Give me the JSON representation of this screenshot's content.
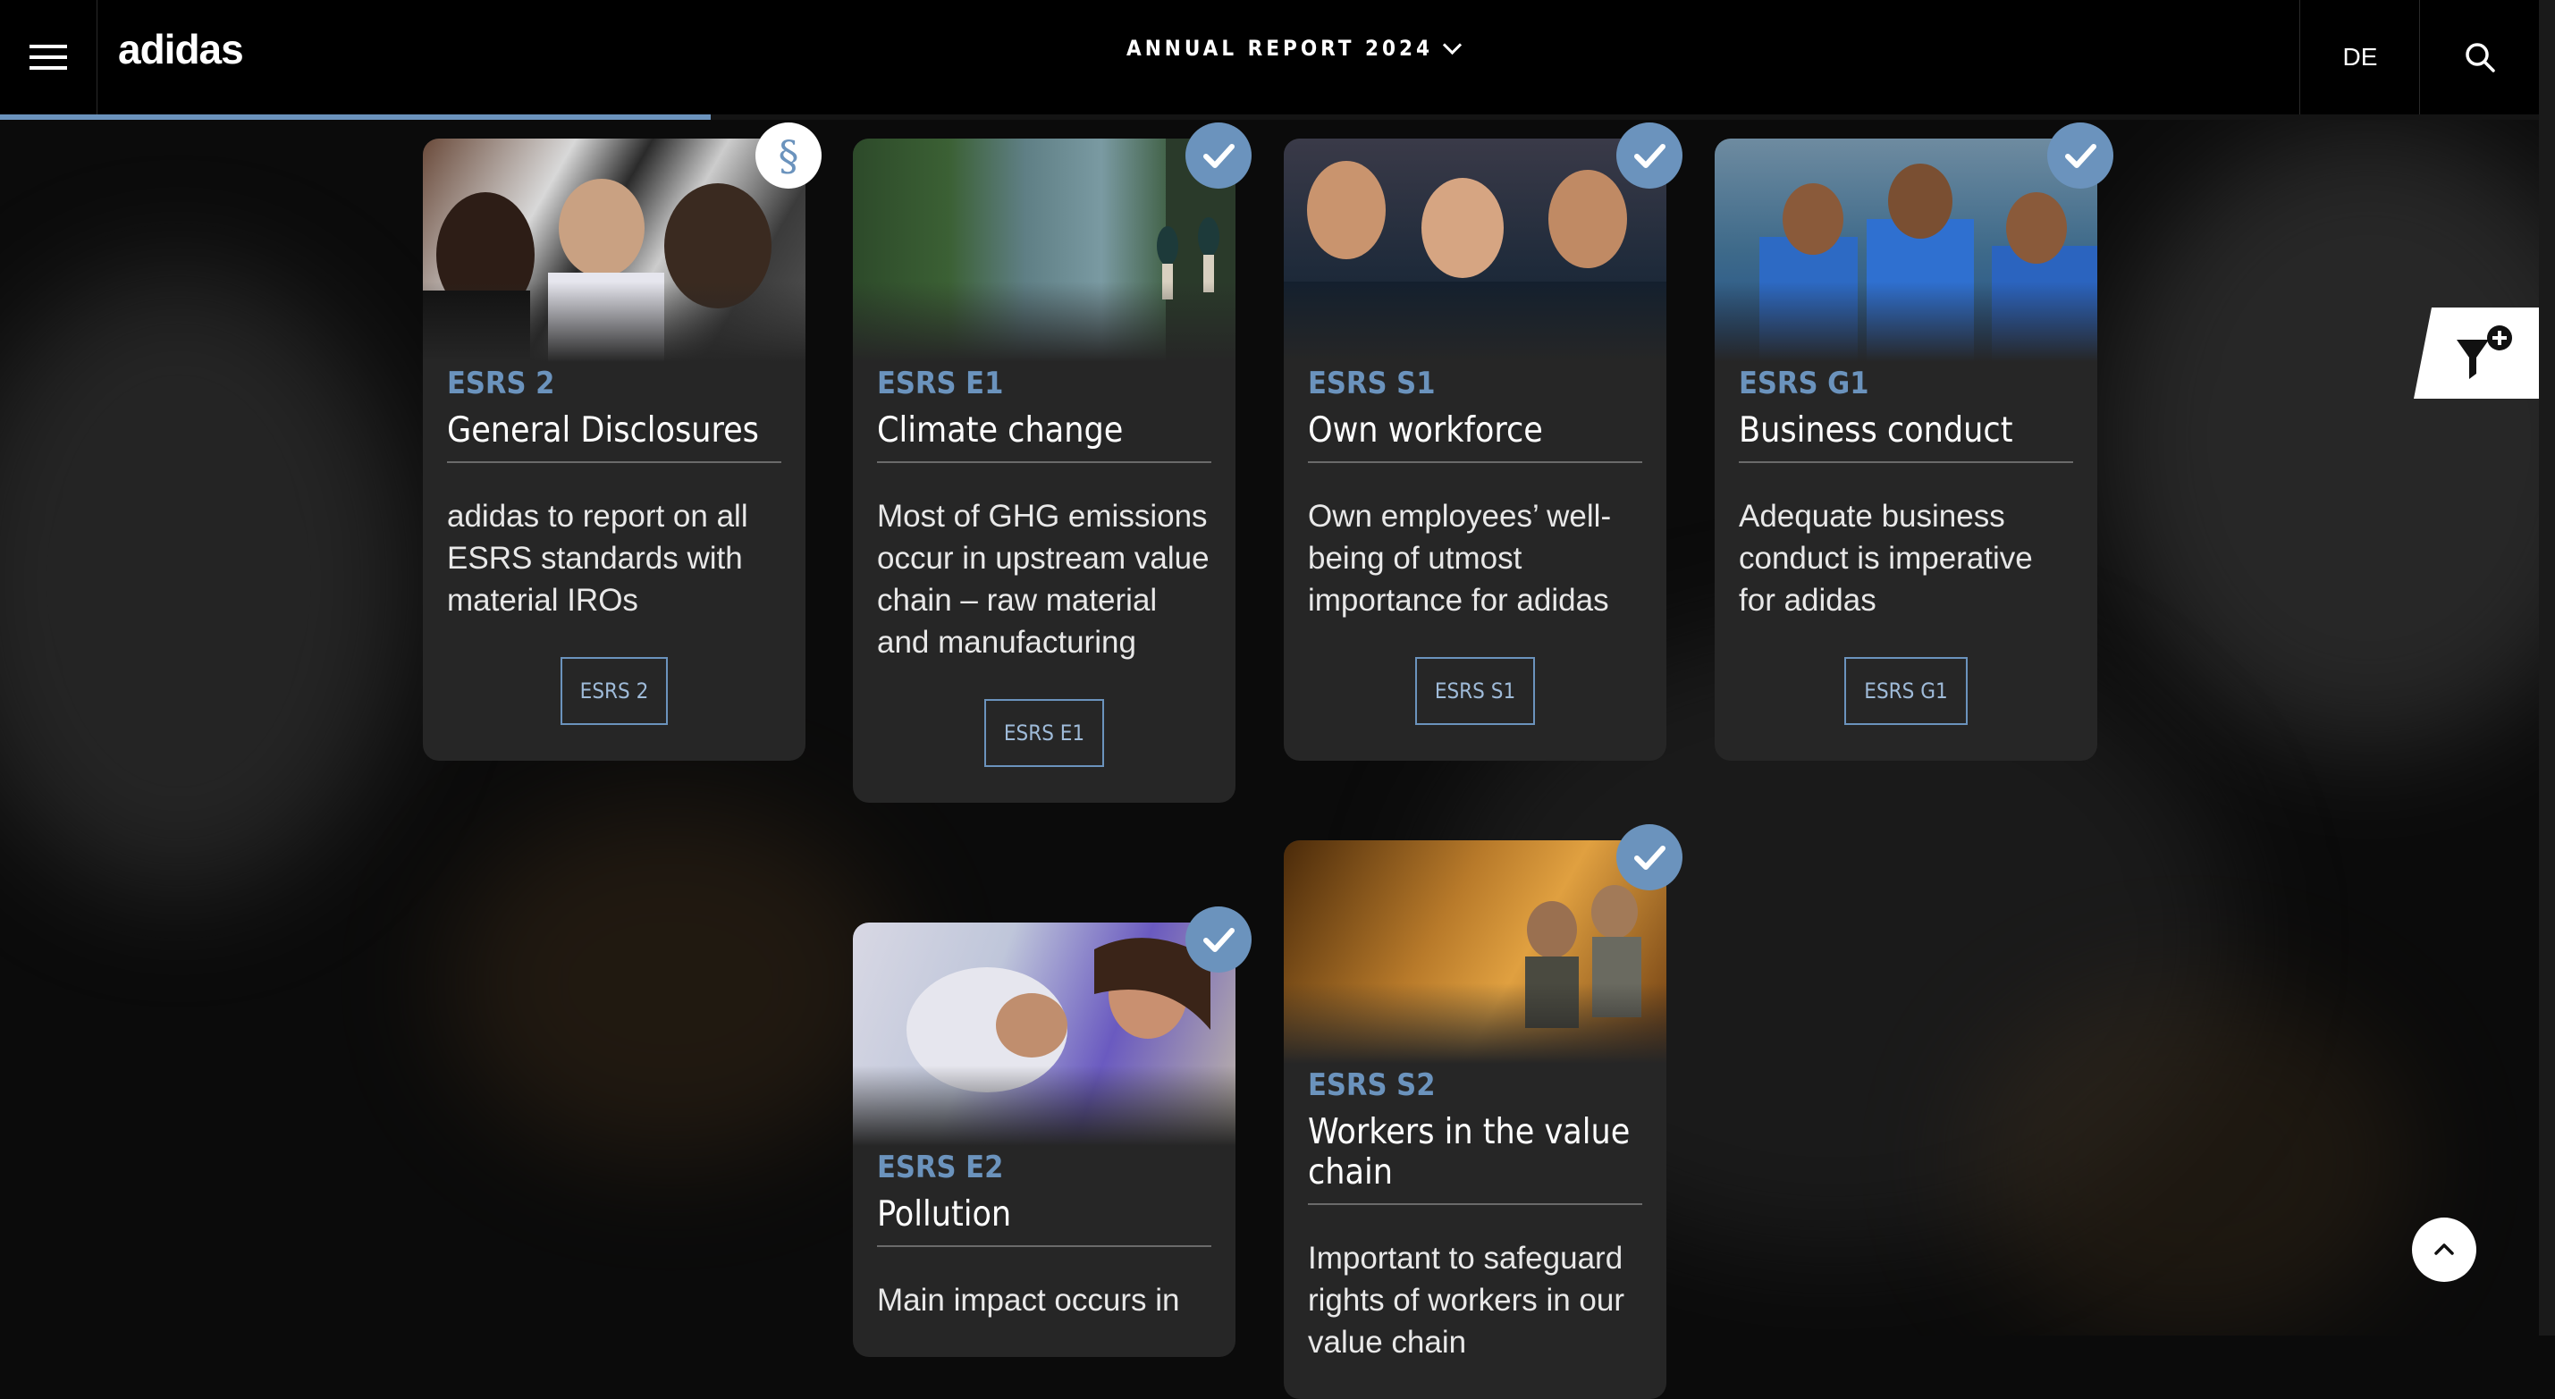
{
  "header": {
    "brand": "adidas",
    "report_title": "ANNUAL REPORT 2024",
    "language": "DE"
  },
  "progress": {
    "value_percent": 28
  },
  "colors": {
    "accent": "#6b93bd",
    "card": "#262626",
    "header": "#000000"
  },
  "cards": [
    {
      "code": "ESRS 2",
      "title": "General Disclosures",
      "description": "adidas to report on all ESRS standards with material IROs",
      "tag": "ESRS 2",
      "badge": "paragraph-icon"
    },
    {
      "code": "ESRS E1",
      "title": "Climate change",
      "description": "Most of GHG emissions occur in upstream value chain – raw material and manufacturing",
      "tag": "ESRS E1",
      "badge": "check-icon"
    },
    {
      "code": "ESRS S1",
      "title": "Own workforce",
      "description": "Own employees’ well-being of utmost importance for adidas",
      "tag": "ESRS S1",
      "badge": "check-icon"
    },
    {
      "code": "ESRS G1",
      "title": "Business conduct",
      "description": "Adequate business conduct is imperative for adidas",
      "tag": "ESRS G1",
      "badge": "check-icon"
    },
    {
      "code": "ESRS E2",
      "title": "Pollution",
      "description": "Main impact occurs in",
      "badge": "check-icon"
    },
    {
      "code": "ESRS S2",
      "title": "Workers in the value chain",
      "description": "Important to safeguard rights of workers in our value chain",
      "badge": "check-icon"
    }
  ],
  "icons": {
    "menu": "hamburger-icon",
    "search": "search-icon",
    "filter": "filter-add-icon",
    "scroll_top": "chevron-up-icon"
  }
}
